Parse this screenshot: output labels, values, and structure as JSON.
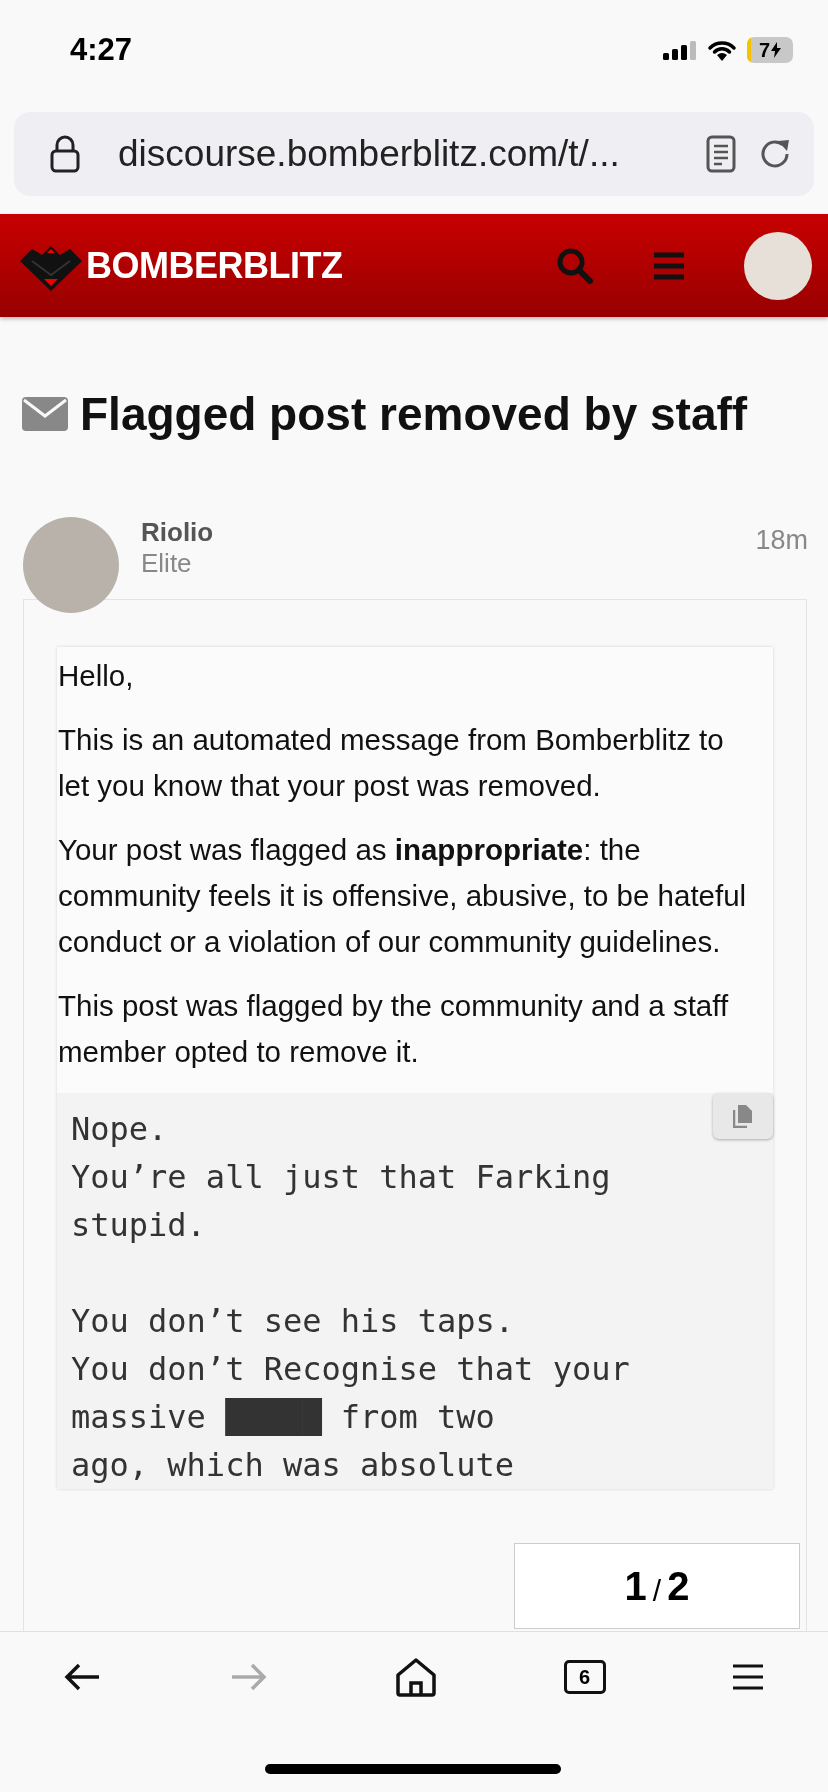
{
  "status_bar": {
    "time": "4:27",
    "battery": "7"
  },
  "browser": {
    "url": "discourse.bomberblitz.com/t/..."
  },
  "site_header": {
    "logo": "BOMBERBLITZ"
  },
  "topic": {
    "title": "Flagged post removed by staff"
  },
  "post": {
    "author": "Riolio",
    "rank": "Elite",
    "time": "18m",
    "paragraphs": [
      "Hello,",
      "This is an automated message from Bomberblitz to let you know that your post was removed.",
      "Your post was flagged as **inappropriate**: the community feels it is offensive, abusive, to be hateful conduct or a violation of our community guidelines.",
      "This post was flagged by the community and a staff member opted to remove it."
    ],
    "code_paragraphs": [
      [
        "Nope.",
        "You’re all just that Farking",
        "stupid."
      ],
      [
        "You don’t see his taps.",
        "You don’t Recognise that your",
        "massive █████ from two",
        "ago, which was absolute"
      ]
    ]
  },
  "progress": {
    "current": "1",
    "separator": "/",
    "total": "2"
  },
  "toolbar": {
    "back_disabled": false,
    "forward_disabled": true,
    "tabs_count": "6"
  }
}
